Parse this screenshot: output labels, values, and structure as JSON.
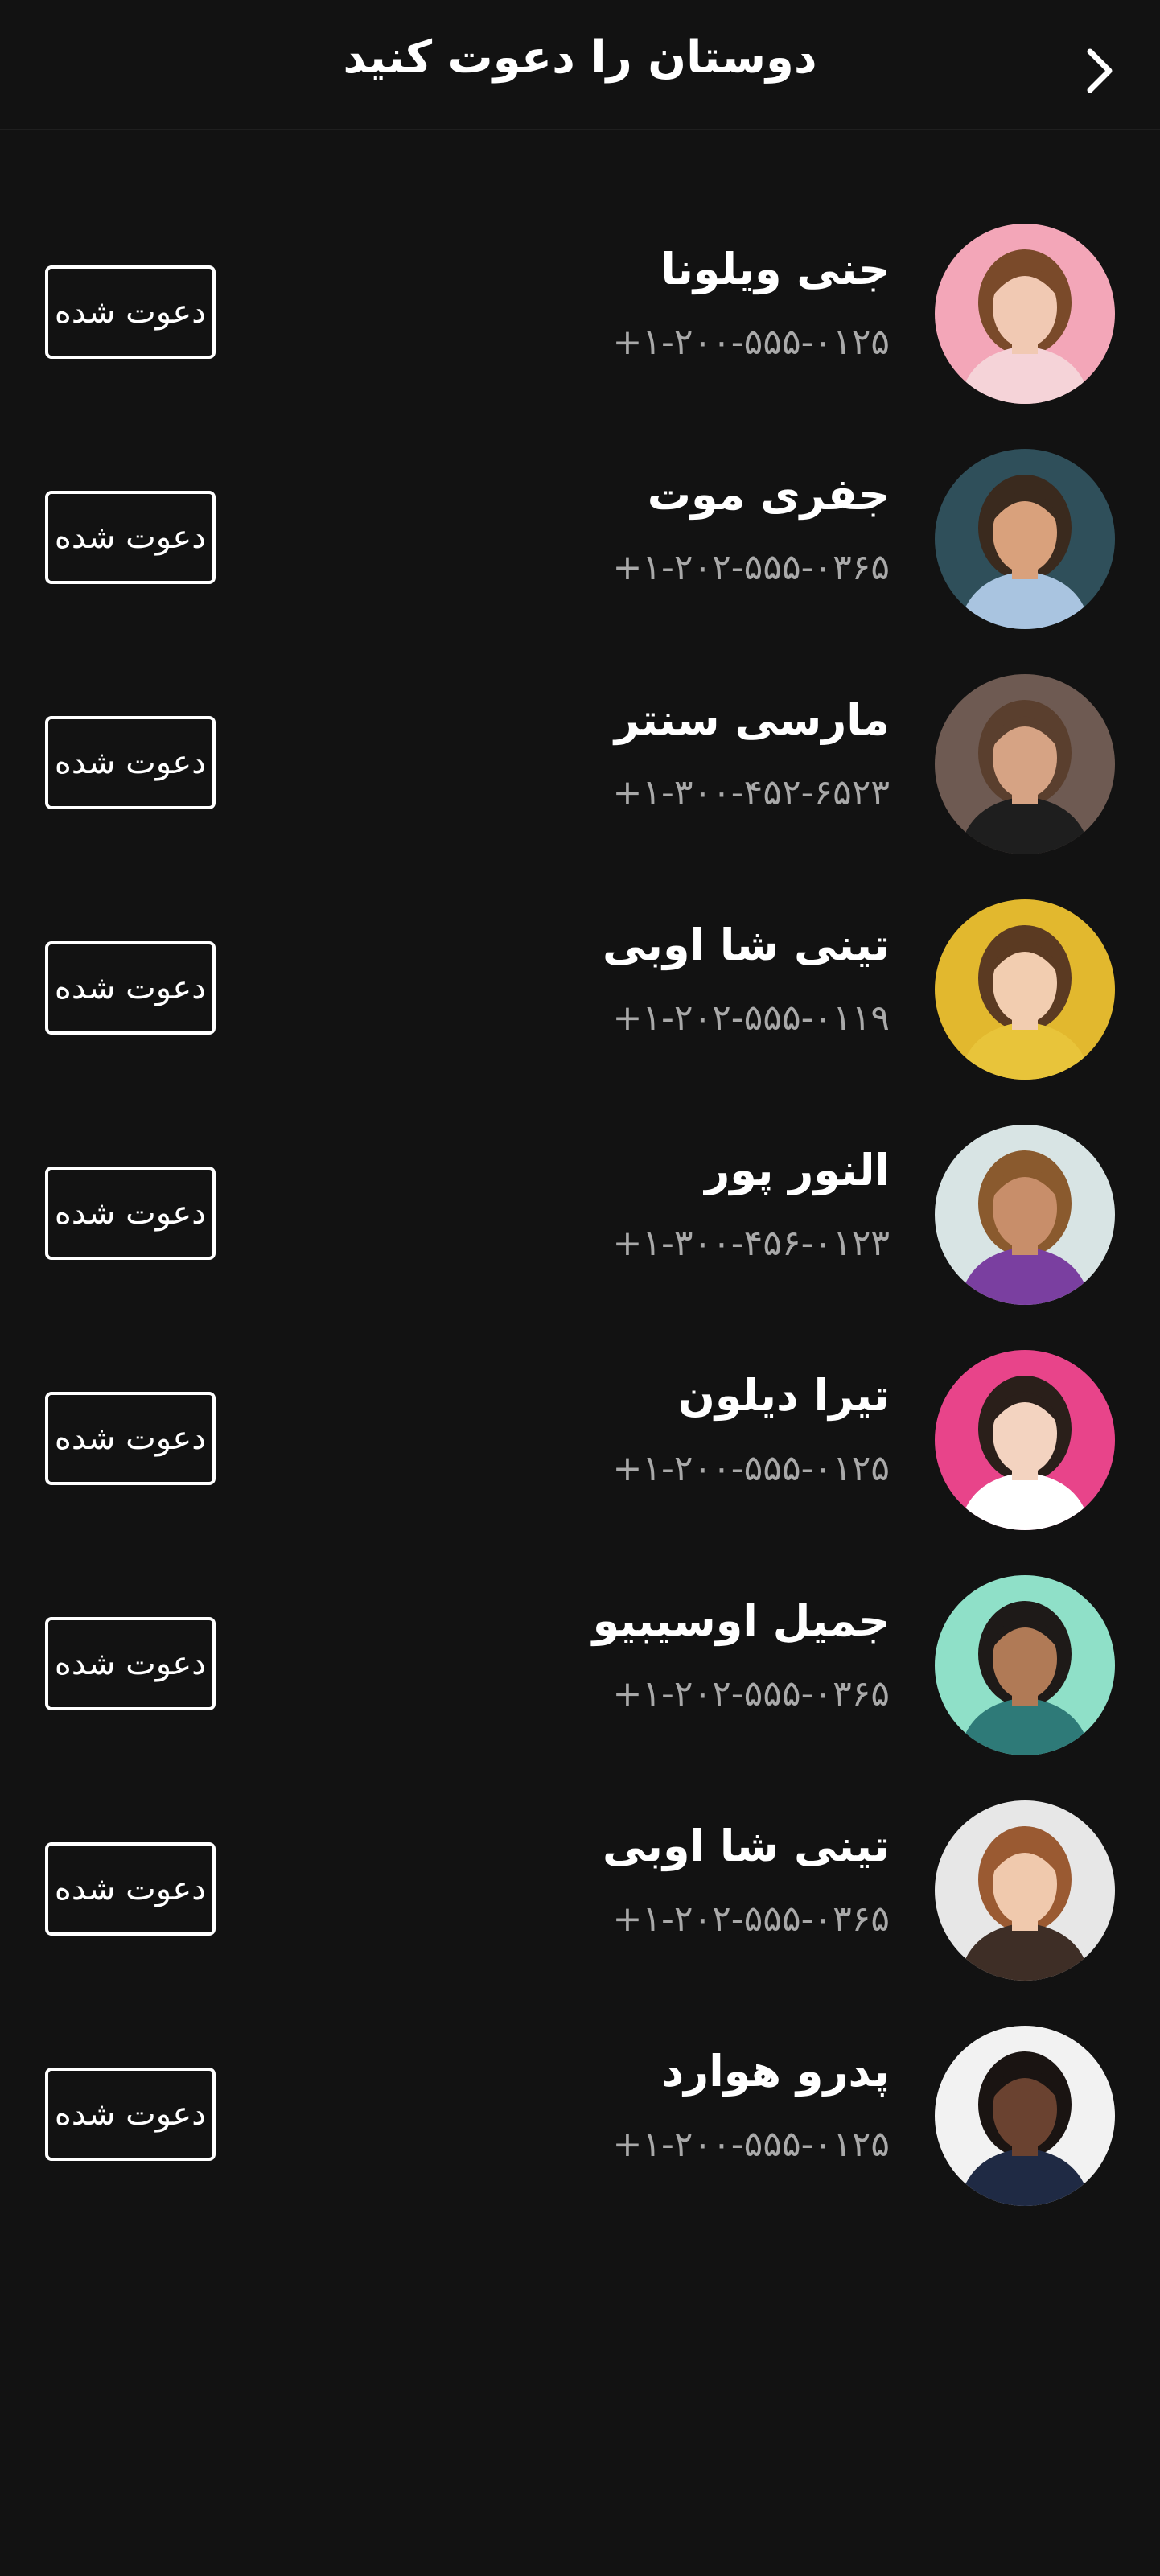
{
  "header": {
    "title": "دوستان را دعوت کنید",
    "back_icon": "chevron-right-icon"
  },
  "contacts": [
    {
      "name": "جنی ویلونا",
      "phone": "+۱-۲۰۰-۵۵۵-۰۱۲۵",
      "button": "دعوت شده",
      "avatar_bg": "#f3a6b8",
      "skin": "#f1c9b3",
      "hair": "#7a4a2a",
      "shirt": "#f5d3d8"
    },
    {
      "name": "جفری موت",
      "phone": "+۱-۲۰۲-۵۵۵-۰۳۶۵",
      "button": "دعوت شده",
      "avatar_bg": "#2f4f5a",
      "skin": "#d9a17c",
      "hair": "#3a2a1e",
      "shirt": "#a9c4e0"
    },
    {
      "name": "مارسی سنتر",
      "phone": "+۱-۳۰۰-۴۵۲-۶۵۲۳",
      "button": "دعوت شده",
      "avatar_bg": "#6e5a52",
      "skin": "#d6a384",
      "hair": "#5a3f2e",
      "shirt": "#1e1e1e"
    },
    {
      "name": "تینی شا اوبی",
      "phone": "+۱-۲۰۲-۵۵۵-۰۱۱۹",
      "button": "دعوت شده",
      "avatar_bg": "#e2b82e",
      "skin": "#f2cdb0",
      "hair": "#5b3a22",
      "shirt": "#e8c43a"
    },
    {
      "name": "النور پور",
      "phone": "+۱-۳۰۰-۴۵۶-۰۱۲۳",
      "button": "دعوت شده",
      "avatar_bg": "#d8e4e4",
      "skin": "#c88e6a",
      "hair": "#8a5a2e",
      "shirt": "#7a3fa0"
    },
    {
      "name": "تیرا دیلون",
      "phone": "+۱-۲۰۰-۵۵۵-۰۱۲۵",
      "button": "دعوت شده",
      "avatar_bg": "#e8448a",
      "skin": "#f3d3c0",
      "hair": "#2a1f1a",
      "shirt": "#ffffff"
    },
    {
      "name": "جمیل اوسیبیو",
      "phone": "+۱-۲۰۲-۵۵۵-۰۳۶۵",
      "button": "دعوت شده",
      "avatar_bg": "#8fe0c8",
      "skin": "#b07a56",
      "hair": "#1e1a18",
      "shirt": "#2e7a78"
    },
    {
      "name": "تینی شا اوبی",
      "phone": "+۱-۲۰۲-۵۵۵-۰۳۶۵",
      "button": "دعوت شده",
      "avatar_bg": "#e7e7e7",
      "skin": "#f0c9ad",
      "hair": "#9a5a32",
      "shirt": "#3e2e26"
    },
    {
      "name": "پدرو هوارد",
      "phone": "+۱-۲۰۰-۵۵۵-۰۱۲۵",
      "button": "دعوت شده",
      "avatar_bg": "#f2f2f2",
      "skin": "#6a4230",
      "hair": "#1a1412",
      "shirt": "#1f2a44"
    }
  ]
}
